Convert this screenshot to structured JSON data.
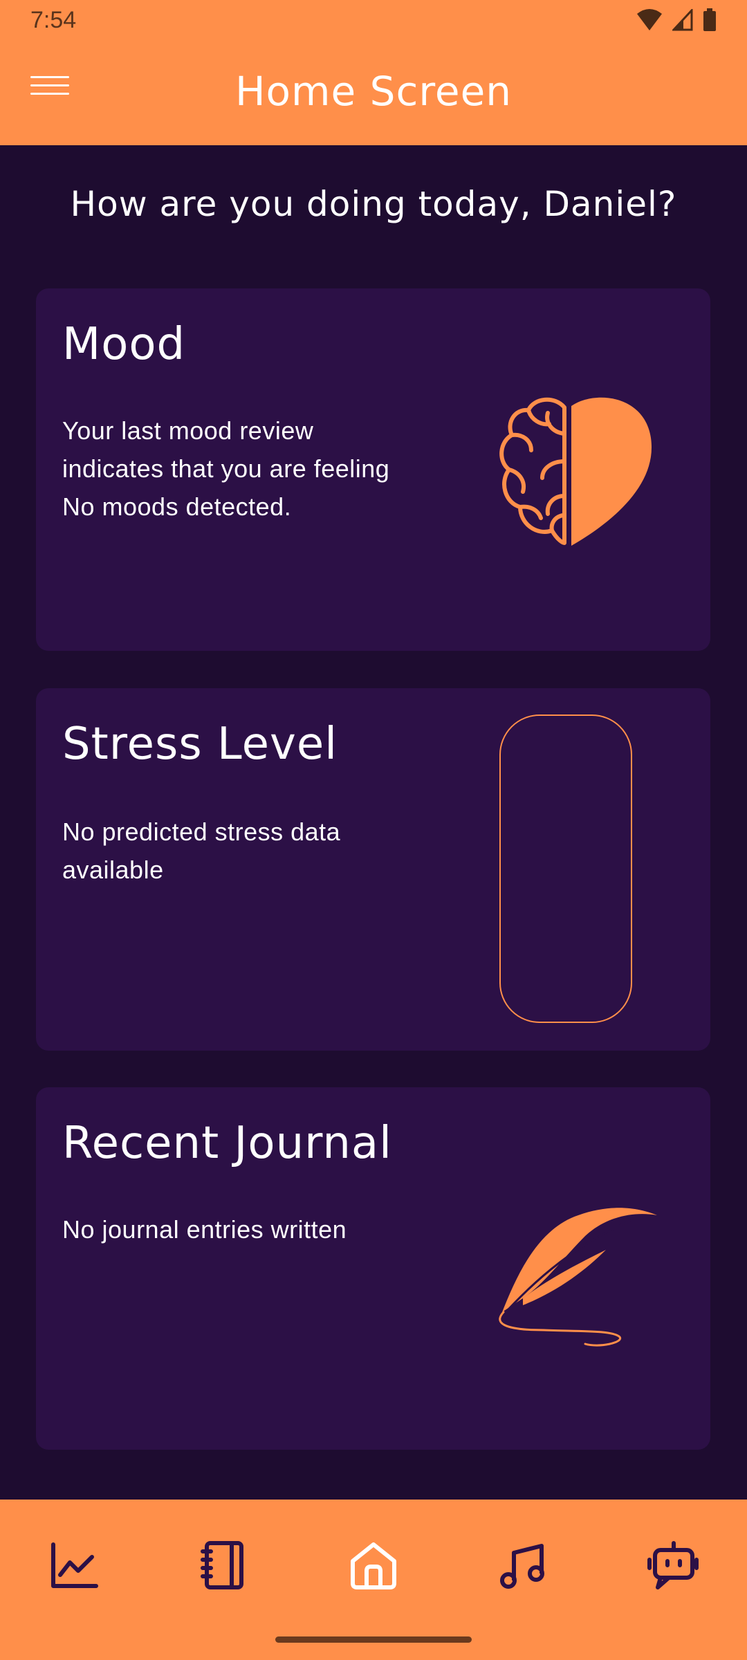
{
  "status_bar": {
    "time": "7:54",
    "icons": [
      "wifi-icon",
      "signal-icon",
      "battery-icon"
    ]
  },
  "app_bar": {
    "title": "Home Screen",
    "menu_icon": "hamburger-menu-icon"
  },
  "greeting": "How are you doing today, Daniel?",
  "cards": {
    "mood": {
      "title": "Mood",
      "text": "Your last mood review indicates that you are feeling No moods detected.",
      "icon": "brain-heart-icon"
    },
    "stress": {
      "title": "Stress Level",
      "text": "No predicted stress data available",
      "icon": "stress-gauge-outline"
    },
    "journal": {
      "title": "Recent Journal",
      "text": "No journal entries written",
      "icon": "quill-feather-icon"
    }
  },
  "bottom_nav": {
    "items": [
      {
        "icon": "chart-line-icon"
      },
      {
        "icon": "journal-notebook-icon"
      },
      {
        "icon": "home-icon",
        "active": true
      },
      {
        "icon": "music-note-icon"
      },
      {
        "icon": "chat-bot-icon"
      }
    ]
  },
  "colors": {
    "accent": "#FF8F4A",
    "background": "#1E0C30",
    "card": "#2C1046",
    "text": "#FFFFFF",
    "nav_icon_inactive": "#2C1046",
    "nav_icon_active": "#FFFFFF"
  }
}
